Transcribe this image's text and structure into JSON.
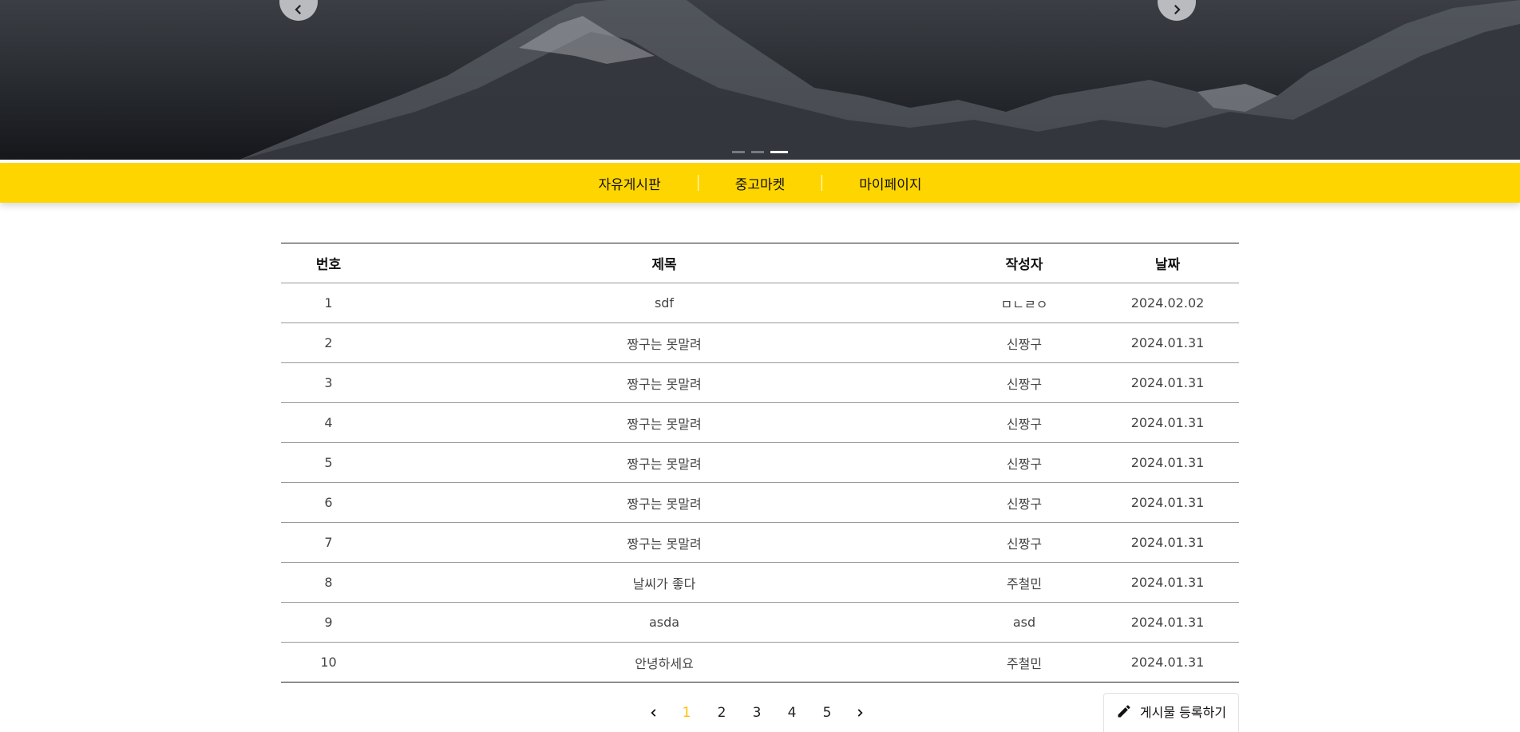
{
  "nav": {
    "items": [
      {
        "label": "자유게시판"
      },
      {
        "label": "중고마켓"
      },
      {
        "label": "마이페이지"
      }
    ]
  },
  "carousel": {
    "slides": 3,
    "active_slide": 3
  },
  "board": {
    "headers": {
      "num": "번호",
      "title": "제목",
      "author": "작성자",
      "date": "날짜"
    },
    "rows": [
      {
        "num": "1",
        "title": "sdf",
        "author": "ㅁㄴㄹㅇ",
        "date": "2024.02.02"
      },
      {
        "num": "2",
        "title": "짱구는 못말려",
        "author": "신짱구",
        "date": "2024.01.31"
      },
      {
        "num": "3",
        "title": "짱구는 못말려",
        "author": "신짱구",
        "date": "2024.01.31"
      },
      {
        "num": "4",
        "title": "짱구는 못말려",
        "author": "신짱구",
        "date": "2024.01.31"
      },
      {
        "num": "5",
        "title": "짱구는 못말려",
        "author": "신짱구",
        "date": "2024.01.31"
      },
      {
        "num": "6",
        "title": "짱구는 못말려",
        "author": "신짱구",
        "date": "2024.01.31"
      },
      {
        "num": "7",
        "title": "짱구는 못말려",
        "author": "신짱구",
        "date": "2024.01.31"
      },
      {
        "num": "8",
        "title": "날씨가 좋다",
        "author": "주철민",
        "date": "2024.01.31"
      },
      {
        "num": "9",
        "title": "asda",
        "author": "asd",
        "date": "2024.01.31"
      },
      {
        "num": "10",
        "title": "안녕하세요",
        "author": "주철민",
        "date": "2024.01.31"
      }
    ]
  },
  "pagination": {
    "pages": [
      "1",
      "2",
      "3",
      "4",
      "5"
    ],
    "current": "1"
  },
  "actions": {
    "write_label": "게시물 등록하기"
  },
  "icons": {
    "prev": "chevron-left-icon",
    "next": "chevron-right-icon",
    "write": "pencil-icon"
  },
  "colors": {
    "accent": "#ffd500",
    "active_page": "#ffc107"
  }
}
